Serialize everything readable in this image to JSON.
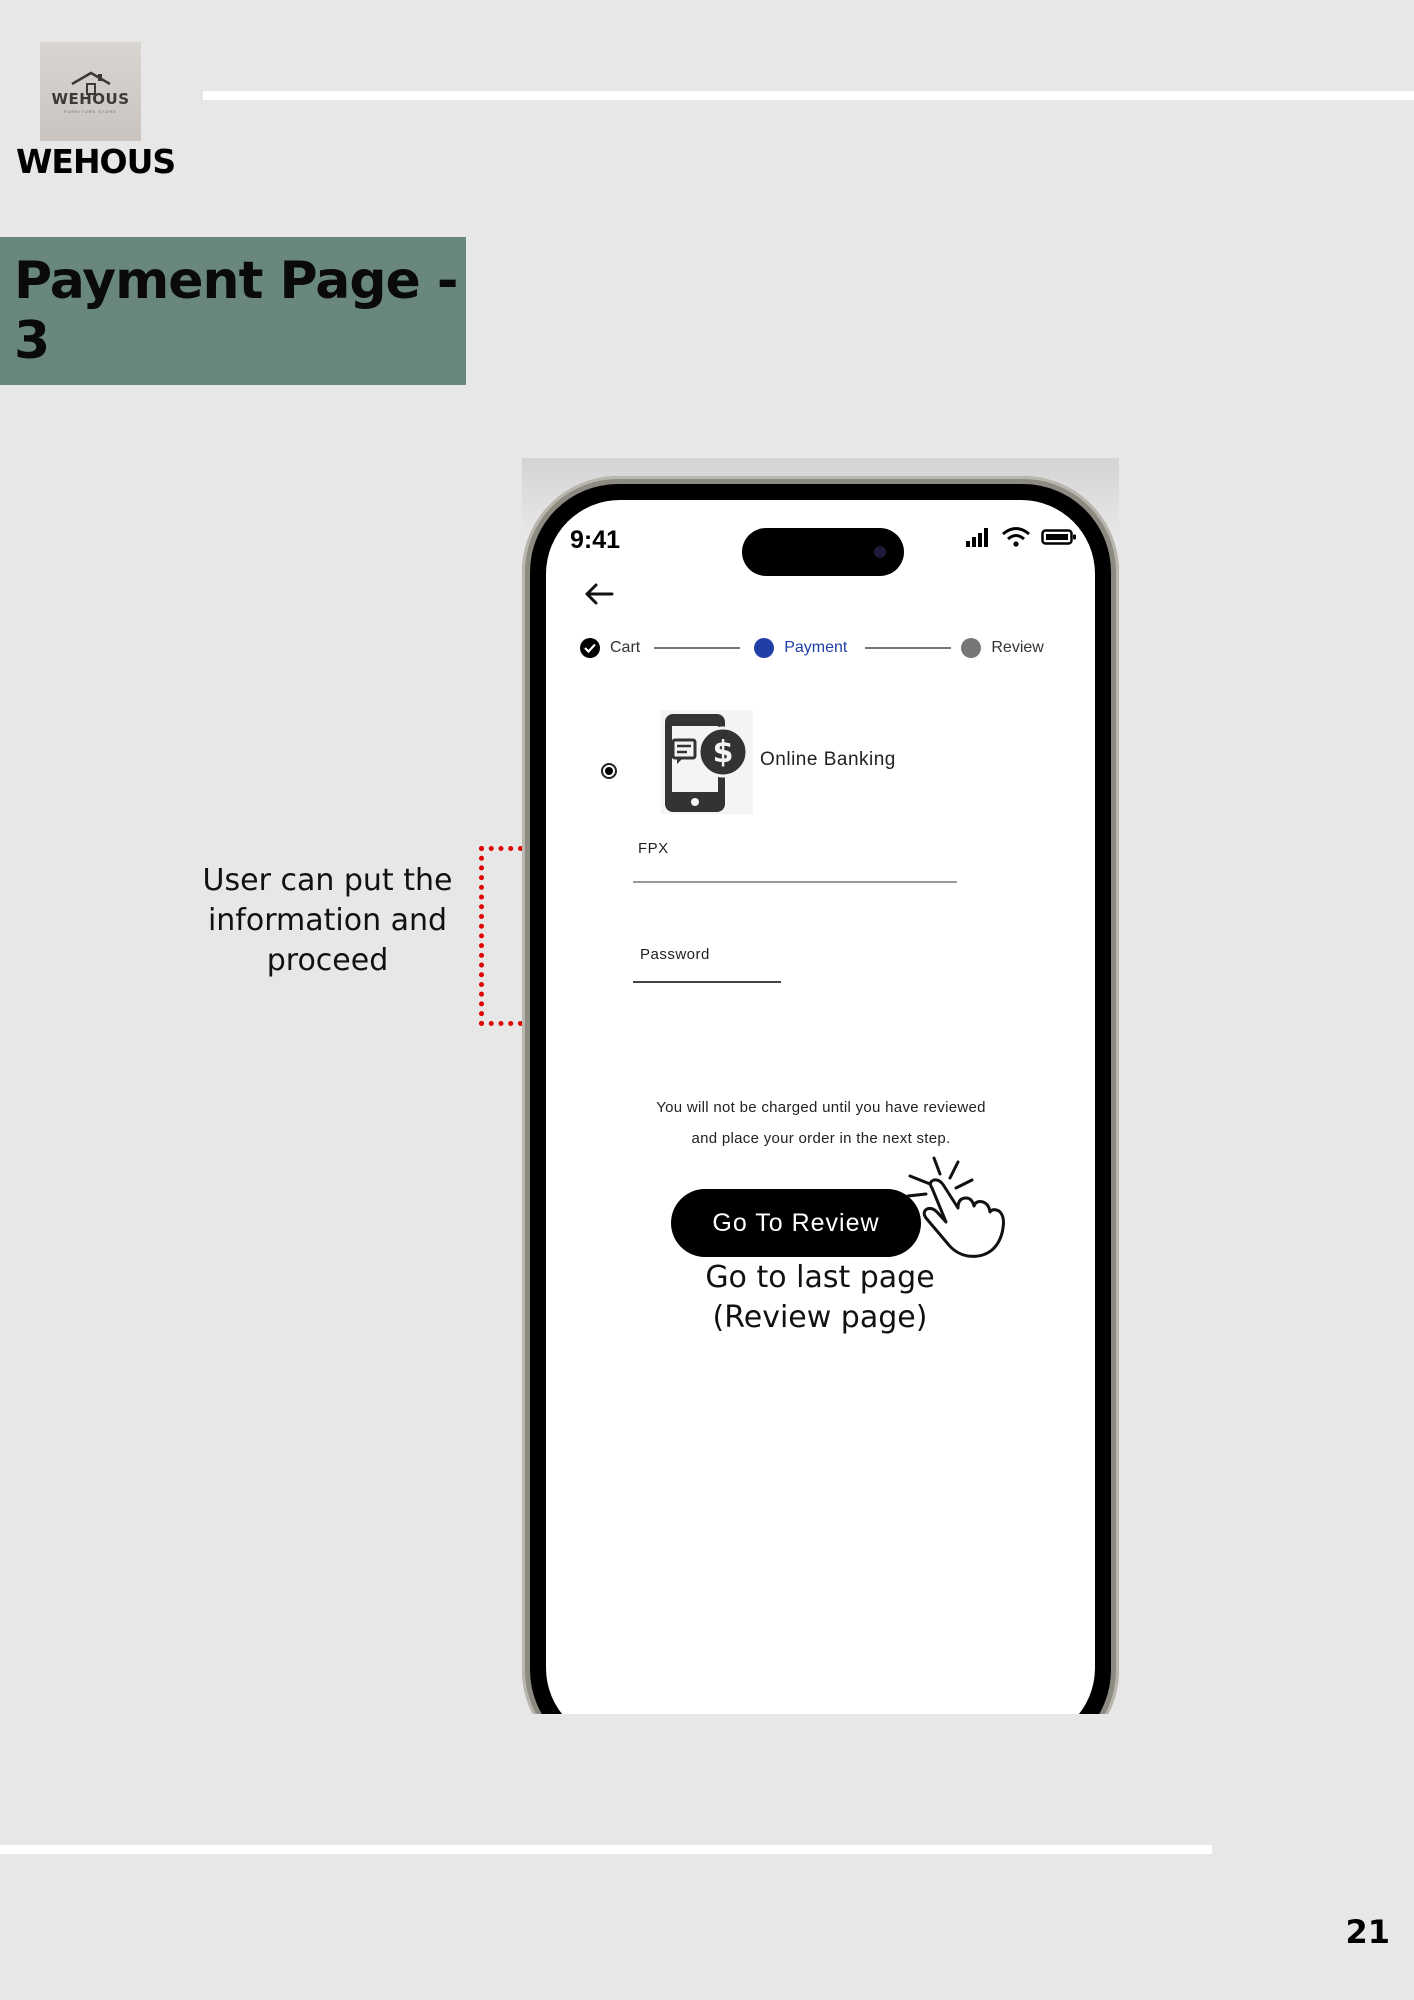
{
  "brand": {
    "logo_text": "WEHOUS",
    "logo_subtext": "FURNITURE STORE",
    "name": "WEHOUS"
  },
  "page": {
    "title": "Payment Page - 3",
    "number": "21"
  },
  "annotations": {
    "form_note": "User can put the information and proceed",
    "button_note_line1": "Go to last page",
    "button_note_line2": "(Review page)"
  },
  "phone": {
    "status": {
      "time": "9:41",
      "icons": [
        "signal-icon",
        "wifi-icon",
        "battery-icon"
      ]
    },
    "back_icon": "back-arrow-icon",
    "stepper": {
      "steps": [
        {
          "label": "Cart",
          "state": "completed"
        },
        {
          "label": "Payment",
          "state": "current"
        },
        {
          "label": "Review",
          "state": "upcoming"
        }
      ],
      "colors": {
        "current": "#1f3fa6",
        "upcoming": "#777777",
        "completed": "#000000"
      }
    },
    "payment_option": {
      "label": "Online Banking",
      "selected": true,
      "icon": "mobile-payment-icon"
    },
    "form": {
      "fpx_label": "FPX",
      "password_label": "Password"
    },
    "notice_line1": "You will not be charged until you have reviewed",
    "notice_line2": "and place your order in the next step.",
    "review_button": "Go To Review"
  },
  "colors": {
    "background": "#e7e7e7",
    "title_band": "#69877f",
    "annotation_bracket": "#e10000"
  }
}
